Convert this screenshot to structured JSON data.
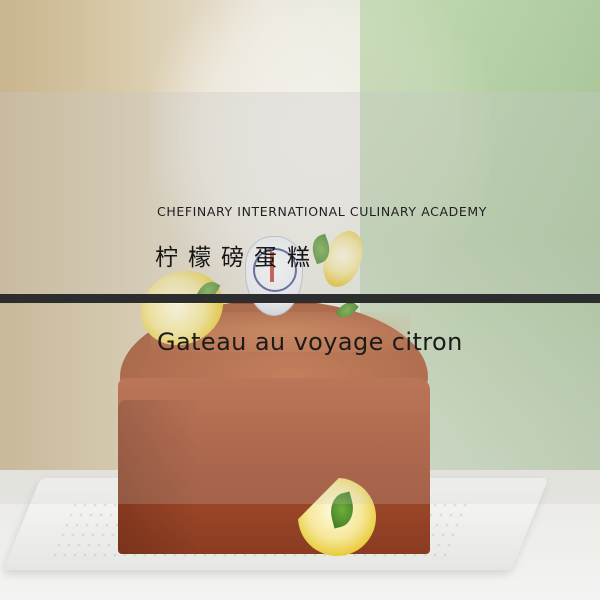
{
  "overlay": {
    "academy_name": "CHEFINARY INTERNATIONAL CULINARY ACADEMY",
    "chinese_title": "柠檬磅蛋糕",
    "french_title": "Gateau au voyage citron"
  },
  "photo": {
    "subject": "lemon pound cake with lemon slices, mint leaves and academy badge on a white plate"
  },
  "colors": {
    "divider": "#2c2d2e",
    "text": "#1b1b1b"
  }
}
